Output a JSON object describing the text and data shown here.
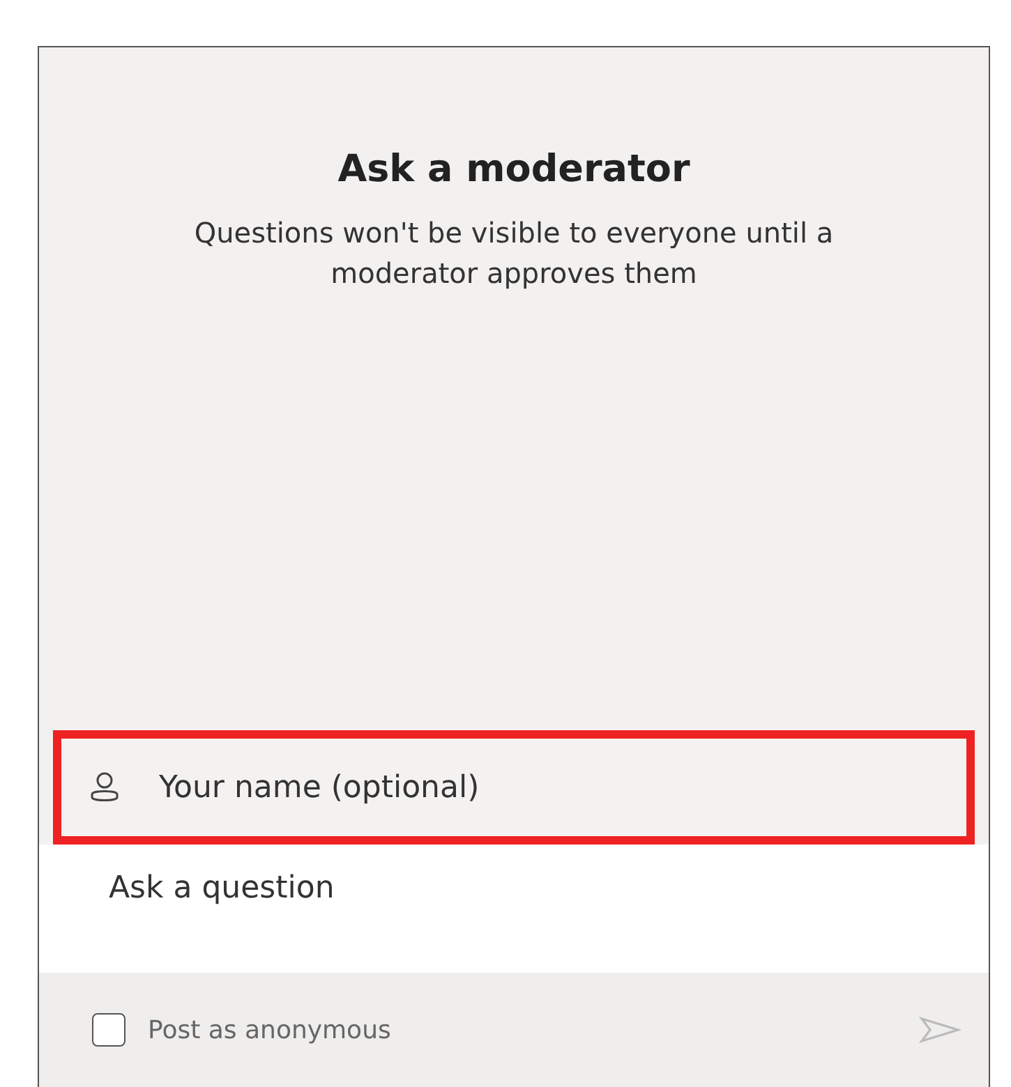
{
  "title": "Ask a moderator",
  "subtitle": "Questions won't be visible to everyone until a moderator approves them",
  "name_field": {
    "placeholder": "Your name (optional)",
    "highlighted": true
  },
  "question_field": {
    "placeholder": "Ask a question"
  },
  "anonymous": {
    "label": "Post as anonymous",
    "checked": false
  },
  "send": {
    "disabled": true
  }
}
